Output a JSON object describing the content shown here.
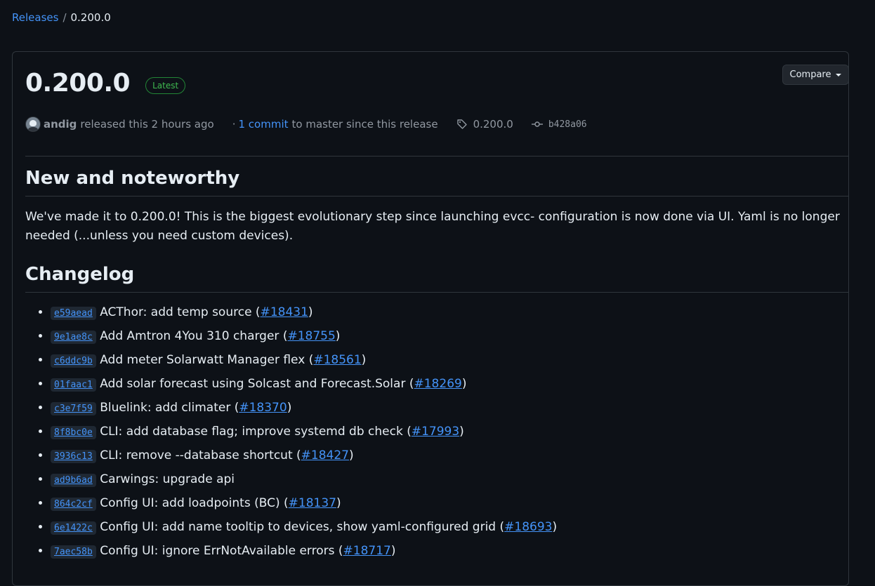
{
  "breadcrumb": {
    "releases": "Releases",
    "sep": "/",
    "current": "0.200.0"
  },
  "release": {
    "title": "0.200.0",
    "badge": "Latest",
    "compare_label": "Compare",
    "author": "andig",
    "released_text": "released this 2 hours ago",
    "dot": "·",
    "commit_link": "1 commit",
    "commit_suffix": "to master since this release",
    "tag": "0.200.0",
    "commit_hash": "b428a06"
  },
  "body": {
    "h_new": "New and noteworthy",
    "description": "We've made it to 0.200.0! This is the biggest evolutionary step since launching evcc- configuration is now done via UI. Yaml is no longer needed (...unless you need custom devices).",
    "h_changelog": "Changelog",
    "changes": [
      {
        "hash": "e59aead",
        "text": "ACThor: add temp source",
        "pr": "#18431"
      },
      {
        "hash": "9e1ae8c",
        "text": "Add Amtron 4You 310 charger",
        "pr": "#18755"
      },
      {
        "hash": "c6ddc9b",
        "text": "Add meter Solarwatt Manager flex",
        "pr": "#18561"
      },
      {
        "hash": "01faac1",
        "text": "Add solar forecast using Solcast and Forecast.Solar",
        "pr": "#18269"
      },
      {
        "hash": "c3e7f59",
        "text": "Bluelink: add climater",
        "pr": "#18370"
      },
      {
        "hash": "8f8bc0e",
        "text": "CLI: add database flag; improve systemd db check",
        "pr": "#17993"
      },
      {
        "hash": "3936c13",
        "text": "CLI: remove --database shortcut",
        "pr": "#18427"
      },
      {
        "hash": "ad9b6ad",
        "text": "Carwings: upgrade api",
        "pr": ""
      },
      {
        "hash": "864c2cf",
        "text": "Config UI: add loadpoints (BC)",
        "pr": "#18137"
      },
      {
        "hash": "6e1422c",
        "text": "Config UI: add name tooltip to devices, show yaml-configured grid",
        "pr": "#18693"
      },
      {
        "hash": "7aec58b",
        "text": "Config UI: ignore ErrNotAvailable errors",
        "pr": "#18717"
      }
    ]
  }
}
